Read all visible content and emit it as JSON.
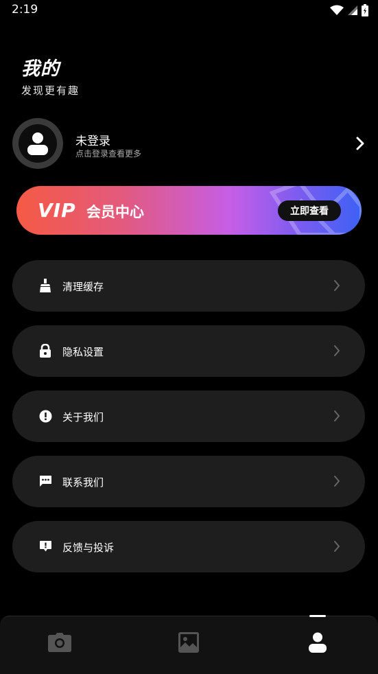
{
  "status_bar": {
    "time": "2:19",
    "icons": [
      "wifi-icon",
      "cell-signal-icon",
      "battery-icon"
    ]
  },
  "header": {
    "title": "我的",
    "subtitle": "发现更有趣"
  },
  "profile": {
    "name": "未登录",
    "hint": "点击登录查看更多",
    "avatar_icon": "user-icon"
  },
  "vip": {
    "logo": "VIP",
    "title": "会员中心",
    "button_label": "立即查看",
    "colors": [
      "#f55a44",
      "#c65ee6",
      "#3d61f5"
    ]
  },
  "menu": {
    "items": [
      {
        "label": "清理缓存",
        "icon": "broom-icon"
      },
      {
        "label": "隐私设置",
        "icon": "lock-icon"
      },
      {
        "label": "关于我们",
        "icon": "info-icon"
      },
      {
        "label": "联系我们",
        "icon": "chat-icon"
      },
      {
        "label": "反馈与投诉",
        "icon": "feedback-icon"
      }
    ]
  },
  "bottom_nav": {
    "items": [
      {
        "icon": "camera-icon",
        "active": false
      },
      {
        "icon": "gallery-icon",
        "active": false
      },
      {
        "icon": "user-icon",
        "active": true
      }
    ]
  }
}
